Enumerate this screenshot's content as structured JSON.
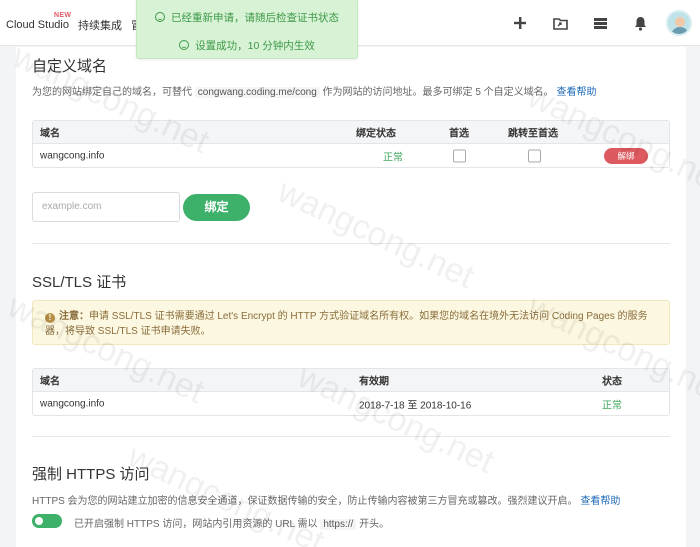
{
  "nav": {
    "items": [
      "Cloud Studio",
      "持续集成",
      "冒"
    ],
    "badge": "NEW",
    "icons": [
      "plus-icon",
      "folder-share-icon",
      "server-icon",
      "bell-icon",
      "user-avatar"
    ]
  },
  "toast": {
    "line1": "已经重新申请，请随后检查证书状态",
    "line2": "设置成功，10 分钟内生效",
    "color": "#3f9a4a"
  },
  "custom_domain": {
    "title": "自定义域名",
    "desc_prefix": "为您的网站绑定自己的域名，可替代",
    "desc_code": "congwang.coding.me/cong",
    "desc_suffix": "作为网站的访问地址。最多可绑定 5 个自定义域名。",
    "help_link": "查看帮助",
    "table": {
      "headers": [
        "域名",
        "绑定状态",
        "首选",
        "跳转至首选"
      ],
      "rows": [
        {
          "domain": "wangcong.info",
          "status": "正常",
          "unbind_label": "解绑"
        }
      ]
    },
    "input_placeholder": "example.com",
    "bind_button": "绑定"
  },
  "ssl": {
    "title": "SSL/TLS 证书",
    "notice_label": "注意：",
    "notice_text": "申请 SSL/TLS 证书需要通过 Let's Encrypt 的 HTTP 方式验证域名所有权。如果您的域名在境外无法访问 Coding Pages 的服务器，将导致 SSL/TLS 证书申请失败。",
    "table": {
      "headers": [
        "域名",
        "有效期",
        "状态"
      ],
      "rows": [
        {
          "domain": "wangcong.info",
          "validity": "2018-7-18 至 2018-10-16",
          "status": "正常"
        }
      ]
    }
  },
  "https": {
    "title": "强制 HTTPS 访问",
    "desc": "HTTPS 会为您的网站建立加密的信息安全通道，保证数据传输的安全，防止传输内容被第三方冒充或篡改。强烈建议开启。",
    "help_link": "查看帮助",
    "toggle_on": true,
    "toggle_text_prefix": "已开启强制 HTTPS 访问，网站内引用资源的 URL 需以",
    "toggle_code": "https://",
    "toggle_text_suffix": "开头。"
  },
  "watermark": "wangcong.net",
  "colors": {
    "accent_green": "#3db06a",
    "danger_red": "#dd5960",
    "link_blue": "#1e6ab8"
  }
}
